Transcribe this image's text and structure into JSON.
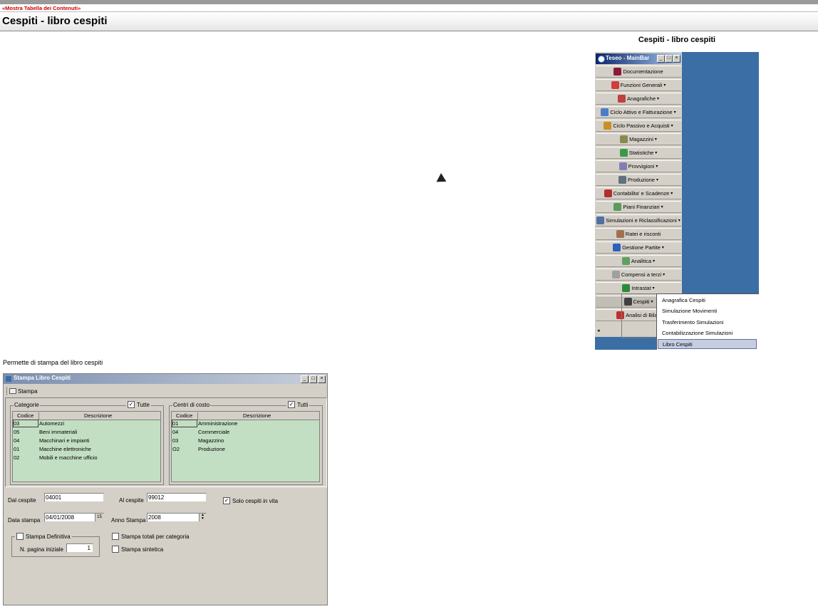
{
  "top": {
    "show_toc": "«Mostra Tabella dei Contenuti»"
  },
  "header": {
    "title": "Cespiti - libro cespiti"
  },
  "figure": {
    "caption": "Cespiti - libro cespiti"
  },
  "description": "Permette di stampa del libro cespiti",
  "mainbar": {
    "title": "Teseo - MainBar",
    "items": [
      {
        "label": "Documentazione",
        "icon": "book-icon",
        "color": "#8b1a3a"
      },
      {
        "label": "Funzioni Generali",
        "icon": "functions-icon",
        "color": "#d23c3c",
        "arrow": true
      },
      {
        "label": "Anagrafiche",
        "icon": "books-icon",
        "color": "#c04040",
        "arrow": true
      },
      {
        "label": "Ciclo Attivo e Fatturazione",
        "icon": "invoice-icon",
        "color": "#4a7ec7",
        "arrow": true
      },
      {
        "label": "Ciclo Passivo e Acquisti",
        "icon": "cart-icon",
        "color": "#c89020",
        "arrow": true
      },
      {
        "label": "Magazzini",
        "icon": "warehouse-icon",
        "color": "#8a8a50",
        "arrow": true
      },
      {
        "label": "Statistiche",
        "icon": "chart-icon",
        "color": "#3a9a4a",
        "arrow": true
      },
      {
        "label": "Provvigioni",
        "icon": "commission-icon",
        "color": "#8080b0",
        "arrow": true
      },
      {
        "label": "Produzione",
        "icon": "gear-icon",
        "color": "#607080",
        "arrow": true
      },
      {
        "label": "Contabilita' e Scadenze",
        "icon": "ledger-icon",
        "color": "#b03030",
        "arrow": true
      },
      {
        "label": "Piani Finanziari",
        "icon": "finance-icon",
        "color": "#5a9a5a",
        "arrow": true
      },
      {
        "label": "Simulazioni e Riclassificazioni",
        "icon": "simulation-icon",
        "color": "#5070a0",
        "arrow": true
      },
      {
        "label": "Ratei e risconti",
        "icon": "accruals-icon",
        "color": "#a07050"
      },
      {
        "label": "Gestione Partite",
        "icon": "partite-icon",
        "color": "#2a60c0",
        "arrow": true
      },
      {
        "label": "Analitica",
        "icon": "analytics-icon",
        "color": "#60a060",
        "arrow": true
      },
      {
        "label": "Compensi a terzi",
        "icon": "payment-icon",
        "color": "#a0a0a0",
        "arrow": true
      },
      {
        "label": "Intrastat",
        "icon": "globe-icon",
        "color": "#2a8a3a",
        "arrow": true
      },
      {
        "label": "Cespiti",
        "icon": "safe-icon",
        "color": "#404040",
        "arrow": true
      },
      {
        "label": "Analisi di Bilan",
        "icon": "balance-chart-icon",
        "color": "#c03030"
      }
    ],
    "submenu": [
      "Anagrafica Cespiti",
      "Simulazione Movimenti",
      "Trasferimento Simulazioni",
      "Contabilizzazione Simulazioni",
      "Libro Cespiti"
    ],
    "selected_submenu": "Libro Cespiti",
    "scroll_arrow": "◂"
  },
  "dialog": {
    "title": "Stampa Libro Cespiti",
    "toolbar_print": "Stampa",
    "categorie": {
      "legend": "Categorie",
      "all_label": "Tutte",
      "all_checked": true,
      "columns": [
        "Codice",
        "Descrizione"
      ],
      "rows": [
        [
          "03",
          "Automezzi"
        ],
        [
          "05",
          "Beni immateriali"
        ],
        [
          "04",
          "Macchinari e impianti"
        ],
        [
          "01",
          "Macchine elettroniche"
        ],
        [
          "02",
          "Mobili e macchine ufficio"
        ]
      ]
    },
    "centri": {
      "legend": "Centri di costo",
      "all_label": "Tutti",
      "all_checked": true,
      "columns": [
        "Codice",
        "Descrizione"
      ],
      "rows": [
        [
          "01",
          "Amministrazione"
        ],
        [
          "04",
          "Commerciale"
        ],
        [
          "03",
          "Magazzino"
        ],
        [
          "O2",
          "Produzione"
        ]
      ]
    },
    "dal_cespite": {
      "label": "Dal cespite",
      "value": "04001"
    },
    "al_cespite": {
      "label": "Al cespite",
      "value": "99012"
    },
    "solo_in_vita": {
      "label": "Solo cespiti in vita",
      "checked": true
    },
    "data_stampa": {
      "label": "Data stampa",
      "value": "04/01/2008",
      "calendar": "15"
    },
    "anno_stampa": {
      "label": "Anno Stampa",
      "value": "2008"
    },
    "stampa_definitiva": {
      "label": "Stampa Definitiva",
      "checked": false
    },
    "pagina_iniziale": {
      "label": "N. pagina iniziale",
      "value": "1"
    },
    "totali_categoria": {
      "label": "Stampa totali per categoria",
      "checked": false
    },
    "sintetica": {
      "label": "Stampa sintetica",
      "checked": false
    },
    "win_buttons": [
      "_",
      "□",
      "×"
    ]
  }
}
